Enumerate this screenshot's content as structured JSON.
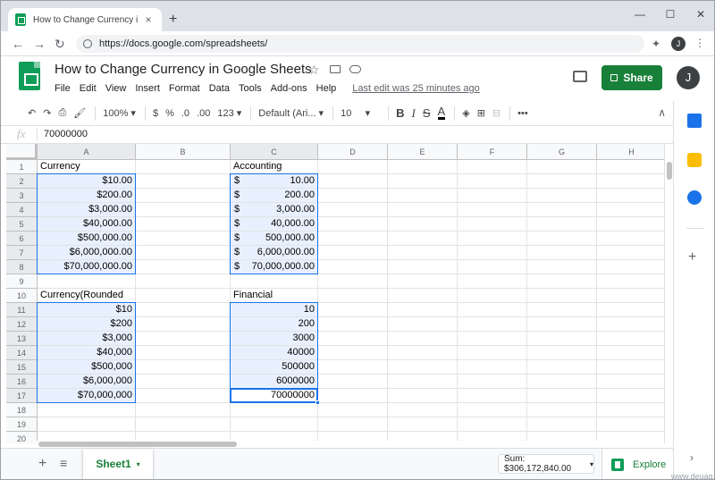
{
  "browser": {
    "tab_title": "How to Change Currency in Google Sheets",
    "tab_close": "×",
    "new_tab": "+",
    "url": "https://docs.google.com/spreadsheets/",
    "profile_initial": "J",
    "win_min": "—",
    "win_max": "☐",
    "win_close": "✕",
    "back": "←",
    "forward": "→",
    "reload": "↻",
    "menu": "⋮",
    "extensions": "✦"
  },
  "doc": {
    "title": "How to Change Currency in Google Sheets",
    "star": "☆",
    "menus": [
      "File",
      "Edit",
      "View",
      "Insert",
      "Format",
      "Data",
      "Tools",
      "Add-ons",
      "Help"
    ],
    "last_edit": "Last edit was 25 minutes ago",
    "share_label": "Share",
    "avatar_initial": "J"
  },
  "toolbar": {
    "undo": "↶",
    "redo": "↷",
    "print": "⎙",
    "paint": "🖌",
    "zoom": "100%",
    "currency": "$",
    "percent": "%",
    "dec_less": ".0",
    "dec_more": ".00",
    "more_formats": "123",
    "font": "Default (Ari...",
    "font_size": "10",
    "bold": "B",
    "italic": "I",
    "strike": "S",
    "text_color": "A",
    "fill": "◈",
    "borders": "⊞",
    "merge": "⊟",
    "more": "•••",
    "collapse": "∧",
    "caret": "▾"
  },
  "formula_bar": {
    "fx": "fx",
    "value": "70000000"
  },
  "grid": {
    "columns": [
      "A",
      "B",
      "C",
      "D",
      "E",
      "F",
      "G",
      "H"
    ],
    "rows": [
      "1",
      "2",
      "3",
      "4",
      "5",
      "6",
      "7",
      "8",
      "9",
      "10",
      "11",
      "12",
      "13",
      "14",
      "15",
      "16",
      "17",
      "18",
      "19",
      "20"
    ],
    "currency_header": "Currency",
    "currency": [
      "$10.00",
      "$200.00",
      "$3,000.00",
      "$40,000.00",
      "$500,000.00",
      "$6,000,000.00",
      "$70,000,000.00"
    ],
    "accounting_header": "Accounting",
    "accounting_symbol": "$",
    "accounting": [
      "10.00",
      "200.00",
      "3,000.00",
      "40,000.00",
      "500,000.00",
      "6,000,000.00",
      "70,000,000.00"
    ],
    "rounded_header": "Currency(Rounded",
    "rounded": [
      "$10",
      "$200",
      "$3,000",
      "$40,000",
      "$500,000",
      "$6,000,000",
      "$70,000,000"
    ],
    "financial_header": "Financial",
    "financial": [
      "10",
      "200",
      "3000",
      "40000",
      "500000",
      "6000000",
      "70000000"
    ]
  },
  "bottom": {
    "add_sheet": "+",
    "all_sheets": "≡",
    "sheet_name": "Sheet1",
    "caret": "▾",
    "sum": "Sum: $306,172,840.00",
    "explore": "Explore"
  },
  "side": {
    "plus": "+",
    "chevron": "›"
  },
  "watermark": "www.deuag.com",
  "colors": {
    "accent_green": "#188038",
    "selection_blue": "#1a73e8",
    "selection_fill": "#e8f0fe"
  }
}
